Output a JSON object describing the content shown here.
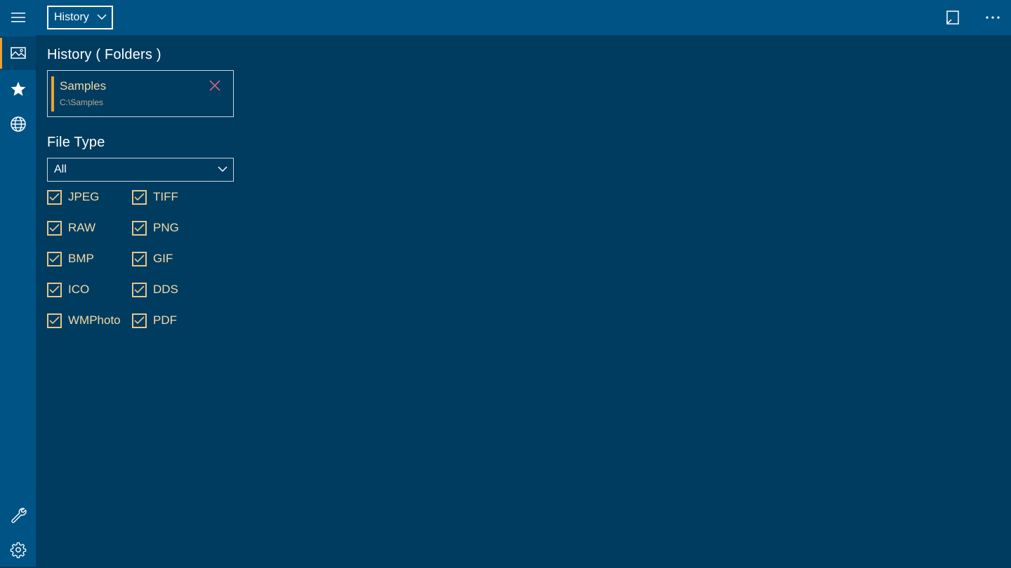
{
  "topbar": {
    "view_select_value": "History",
    "menu_icon": "hamburger-menu-icon",
    "right_icons": [
      "open-panel-icon",
      "more-options-icon"
    ]
  },
  "rail": {
    "items": [
      {
        "icon": "image-icon",
        "active": true
      },
      {
        "icon": "star-icon",
        "active": false
      },
      {
        "icon": "globe-icon",
        "active": false
      }
    ],
    "bottom_items": [
      {
        "icon": "wrench-icon"
      },
      {
        "icon": "gear-icon"
      }
    ]
  },
  "history": {
    "title": "History ( Folders )",
    "folders": [
      {
        "name": "Samples",
        "path": "C:\\Samples"
      }
    ]
  },
  "file_type": {
    "title": "File Type",
    "selected": "All",
    "options": [
      {
        "label": "JPEG",
        "checked": true
      },
      {
        "label": "TIFF",
        "checked": true
      },
      {
        "label": "RAW",
        "checked": true
      },
      {
        "label": "PNG",
        "checked": true
      },
      {
        "label": "BMP",
        "checked": true
      },
      {
        "label": "GIF",
        "checked": true
      },
      {
        "label": "ICO",
        "checked": true
      },
      {
        "label": "DDS",
        "checked": true
      },
      {
        "label": "WMPhoto",
        "checked": true
      },
      {
        "label": "PDF",
        "checked": true
      }
    ]
  },
  "colors": {
    "background": "#003c60",
    "chrome": "#005485",
    "accent": "#f0a030",
    "label_text": "#f3d9a8",
    "close_x": "#e0607a"
  }
}
